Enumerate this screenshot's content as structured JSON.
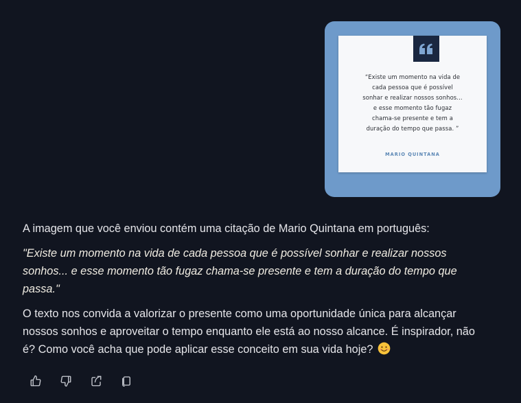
{
  "uploaded_image": {
    "quote_lines": [
      "“Existe um momento na vida de",
      "cada pessoa que é possível",
      "sonhar e realizar nossos sonhos…",
      "e esse momento tão fugaz",
      "chama-se presente e tem a",
      "duração do tempo que passa. ”"
    ],
    "author": "MARIO QUINTANA",
    "colors": {
      "frame": "#6e9aca",
      "panel": "#f7f8fa",
      "quote_badge": "#1a2740",
      "author_text": "#5b87b5"
    }
  },
  "message": {
    "intro": "A imagem que você enviou contém uma citação de Mario Quintana em português:",
    "quote_lines": [
      "\"Existe um momento na vida de cada pessoa que é possível sonhar e realizar nossos",
      "sonhos... e esse momento tão fugaz chama-se presente e tem a duração do tempo que",
      "passa.\""
    ],
    "body_lines": [
      "O texto nos convida a valorizar o presente como uma oportunidade única para alcançar",
      "nossos sonhos e aproveitar o tempo enquanto ele está ao nosso alcance. É inspirador, não",
      "é? Como você acha que pode aplicar esse conceito em sua vida hoje?"
    ],
    "emoji": "smiling-face-icon"
  },
  "actions": [
    {
      "name": "thumbs-up",
      "icon": "thumbs-up-icon"
    },
    {
      "name": "thumbs-down",
      "icon": "thumbs-down-icon"
    },
    {
      "name": "share",
      "icon": "share-icon"
    },
    {
      "name": "copy",
      "icon": "copy-icon"
    }
  ],
  "colors": {
    "background": "#111520",
    "text": "#e6e6ea",
    "icon": "#c9ccd3"
  }
}
